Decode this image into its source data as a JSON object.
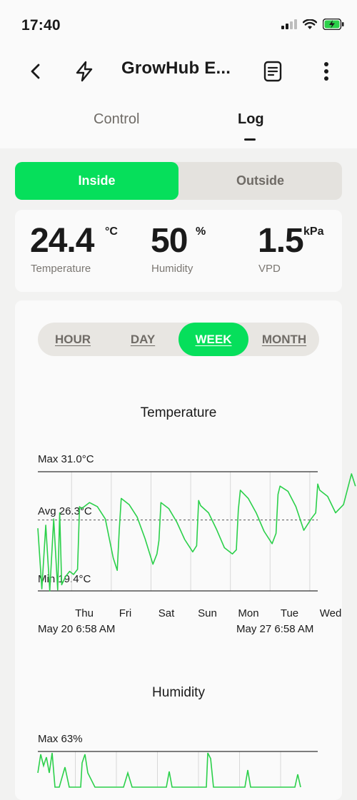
{
  "status_bar": {
    "time": "17:40",
    "icons": [
      "signal-icon",
      "wifi-icon",
      "battery-charging-icon"
    ]
  },
  "nav": {
    "title": "GrowHub E...",
    "icons": [
      "back-icon",
      "lightning-icon",
      "document-icon",
      "more-icon"
    ]
  },
  "tabs": [
    {
      "label": "Control",
      "active": false
    },
    {
      "label": "Log",
      "active": true
    }
  ],
  "location_toggle": {
    "options": [
      "Inside",
      "Outside"
    ],
    "selected": "Inside"
  },
  "readings": [
    {
      "value": "24.4",
      "unit": "°C",
      "label": "Temperature"
    },
    {
      "value": "50",
      "unit": "%",
      "label": "Humidity"
    },
    {
      "value": "1.5",
      "unit": "kPa",
      "label": "VPD"
    }
  ],
  "time_range": {
    "options": [
      "HOUR",
      "DAY",
      "WEEK",
      "MONTH"
    ],
    "selected": "WEEK"
  },
  "colors": {
    "accent": "#06df5b",
    "line": "#2bd04a"
  },
  "chart_data": [
    {
      "type": "line",
      "title": "Temperature",
      "max_label": "Max 31.0°C",
      "avg_label": "Avg 26.3°C",
      "min_label": "Min 19.4°C",
      "ylim": [
        19.4,
        31.0
      ],
      "avg": 26.3,
      "day_ticks": [
        "Thu",
        "Fri",
        "Sat",
        "Sun",
        "Mon",
        "Tue",
        "Wed"
      ],
      "start_label": "May 20 6:58 AM",
      "end_label": "May 27 6:58 AM",
      "x_days": [
        0,
        0.1,
        0.2,
        0.3,
        0.4,
        0.5,
        0.55,
        0.6,
        0.7,
        0.8,
        0.9,
        1.0,
        1.05,
        1.1,
        1.3,
        1.5,
        1.7,
        1.9,
        2.0,
        2.05,
        2.1,
        2.3,
        2.5,
        2.7,
        2.9,
        3.0,
        3.05,
        3.1,
        3.3,
        3.5,
        3.7,
        3.9,
        4.0,
        4.05,
        4.1,
        4.3,
        4.5,
        4.7,
        4.9,
        5.0,
        5.05,
        5.1,
        5.3,
        5.5,
        5.7,
        5.9,
        6.0,
        6.05,
        6.1,
        6.3,
        6.5,
        6.7,
        6.9,
        7.0,
        7.05,
        7.1,
        7.3,
        7.5,
        7.7,
        7.9,
        8.0
      ],
      "values": [
        25.5,
        19.6,
        25.8,
        19.4,
        26.4,
        19.5,
        27.0,
        20.0,
        20.8,
        21.3,
        21.0,
        21.5,
        27.6,
        27.4,
        28.0,
        27.6,
        26.4,
        22.6,
        21.4,
        25.3,
        28.4,
        27.8,
        26.6,
        24.5,
        22.0,
        23.0,
        24.3,
        28.0,
        27.4,
        26.1,
        24.4,
        23.2,
        23.8,
        28.2,
        27.7,
        27.0,
        25.4,
        23.6,
        23.0,
        23.4,
        27.3,
        29.2,
        28.4,
        27.0,
        25.2,
        24.0,
        25.0,
        28.8,
        29.6,
        29.1,
        27.6,
        25.3,
        26.5,
        27.0,
        29.8,
        29.2,
        28.6,
        27.0,
        27.8,
        30.8,
        29.6
      ]
    },
    {
      "type": "line",
      "title": "Humidity",
      "max_label": "Max 63%"
    }
  ]
}
